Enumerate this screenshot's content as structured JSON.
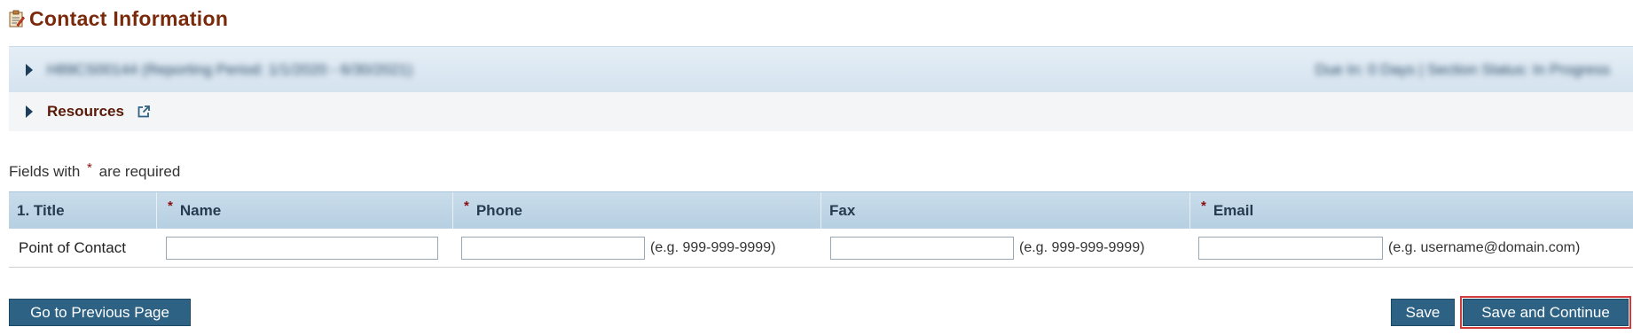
{
  "page": {
    "title": "Contact Information",
    "title_icon": "clipboard-edit-icon"
  },
  "accordions": [
    {
      "left_text": "H89CS00144 (Reporting Period: 1/1/2020 - 6/30/2021)",
      "right_text": "Due In: 0 Days | Section Status: In Progress",
      "obscured": true
    },
    {
      "label": "Resources",
      "icon": "external-link-icon"
    }
  ],
  "required_note": {
    "prefix": "Fields with",
    "suffix": "are required",
    "marker": "*"
  },
  "table": {
    "headers": [
      {
        "label": "1. Title",
        "required": false
      },
      {
        "label": "Name",
        "required": true
      },
      {
        "label": "Phone",
        "required": true
      },
      {
        "label": "Fax",
        "required": false
      },
      {
        "label": "Email",
        "required": true
      }
    ],
    "rows": [
      {
        "title": "Point of Contact",
        "name": "",
        "phone": "",
        "phone_hint": "(e.g. 999-999-9999)",
        "fax": "",
        "fax_hint": "(e.g. 999-999-9999)",
        "email": "",
        "email_hint": "(e.g. username@domain.com)"
      }
    ]
  },
  "buttons": {
    "previous": "Go to Previous Page",
    "save": "Save",
    "save_continue": "Save and Continue"
  },
  "colors": {
    "title": "#7a2a0a",
    "button": "#2e6284",
    "required_star": "#8a0d0d",
    "highlight_border": "#d23b3b"
  }
}
